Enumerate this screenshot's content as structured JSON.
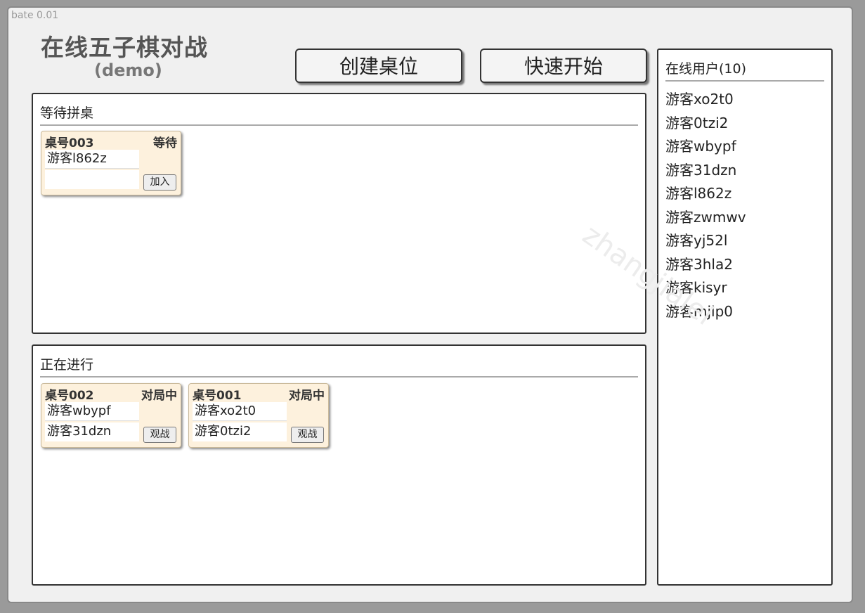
{
  "version": "bate 0.01",
  "header": {
    "title": "在线五子棋对战",
    "subtitle": "(demo)"
  },
  "toolbar": {
    "create_label": "创建桌位",
    "quick_label": "快速开始"
  },
  "waiting": {
    "title": "等待拼桌",
    "desks": [
      {
        "number": "桌号003",
        "status": "等待",
        "player1": "游客l862z",
        "player2": "",
        "action": "加入"
      }
    ]
  },
  "playing": {
    "title": "正在进行",
    "desks": [
      {
        "number": "桌号002",
        "status": "对局中",
        "player1": "游客wbypf",
        "player2": "游客31dzn",
        "action": "观战"
      },
      {
        "number": "桌号001",
        "status": "对局中",
        "player1": "游客xo2t0",
        "player2": "游客0tzi2",
        "action": "观战"
      }
    ]
  },
  "users": {
    "title": "在线用户(10)",
    "list": [
      "游客xo2t0",
      "游客0tzi2",
      "游客wbypf",
      "游客31dzn",
      "游客l862z",
      "游客zwmwv",
      "游客yj52l",
      "游客3hla2",
      "游客kisyr",
      "游客mjlp0"
    ]
  },
  "watermark": "zhangjialei"
}
